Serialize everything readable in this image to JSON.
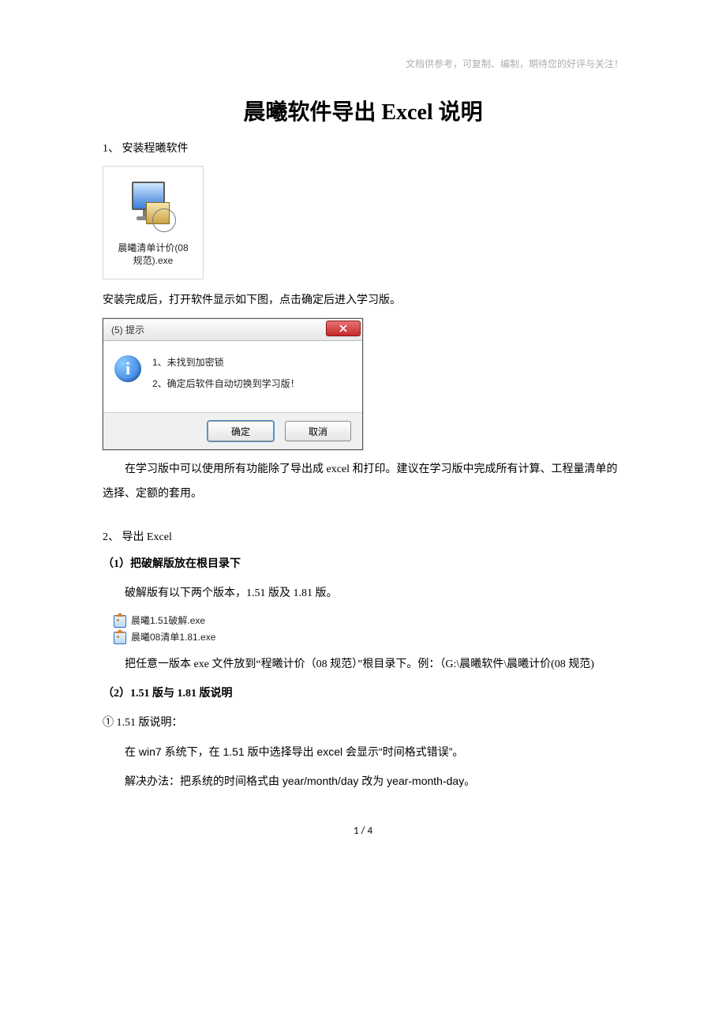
{
  "header_note": "文档供参考，可复制、编制，期待您的好评与关注！",
  "title": "晨曦软件导出 Excel 说明",
  "section1": {
    "heading": "1、 安装程曦软件",
    "installer_label_l1": "晨曦清单计价(08",
    "installer_label_l2": "规范).exe",
    "after_install": "安装完成后，打开软件显示如下图，点击确定后进入学习版。"
  },
  "dialog": {
    "title": "(5) 提示",
    "line1": "1、未找到加密锁",
    "line2": "2、确定后软件自动切换到学习版！",
    "ok": "确定",
    "cancel": "取消"
  },
  "after_dialog": "在学习版中可以使用所有功能除了导出成 excel 和打印。建议在学习版中完成所有计算、工程量清单的选择、定额的套用。",
  "section2": {
    "heading": "2、 导出 Excel",
    "sub1": "（1）把破解版放在根目录下",
    "sub1_para": "破解版有以下两个版本，1.51 版及 1.81 版。",
    "exe1": "晨曦1.51破解.exe",
    "exe2": "晨曦08清单1.81.exe",
    "sub1_para2": "把任意一版本 exe 文件放到“程曦计价（08 规范）”根目录下。例：（G:\\晨曦软件\\晨曦计价(08 规范)",
    "sub2": "（2）1.51 版与 1.81 版说明",
    "sub2_item1": "① 1.51 版说明：",
    "sub2_item1_p1": "在 win7 系统下，在 1.51 版中选择导出 excel 会显示“时间格式错误”。",
    "sub2_item1_p2": "解决办法：把系统的时间格式由 year/month/day  改为  year-month-day。"
  },
  "page_num": "1  /  4"
}
